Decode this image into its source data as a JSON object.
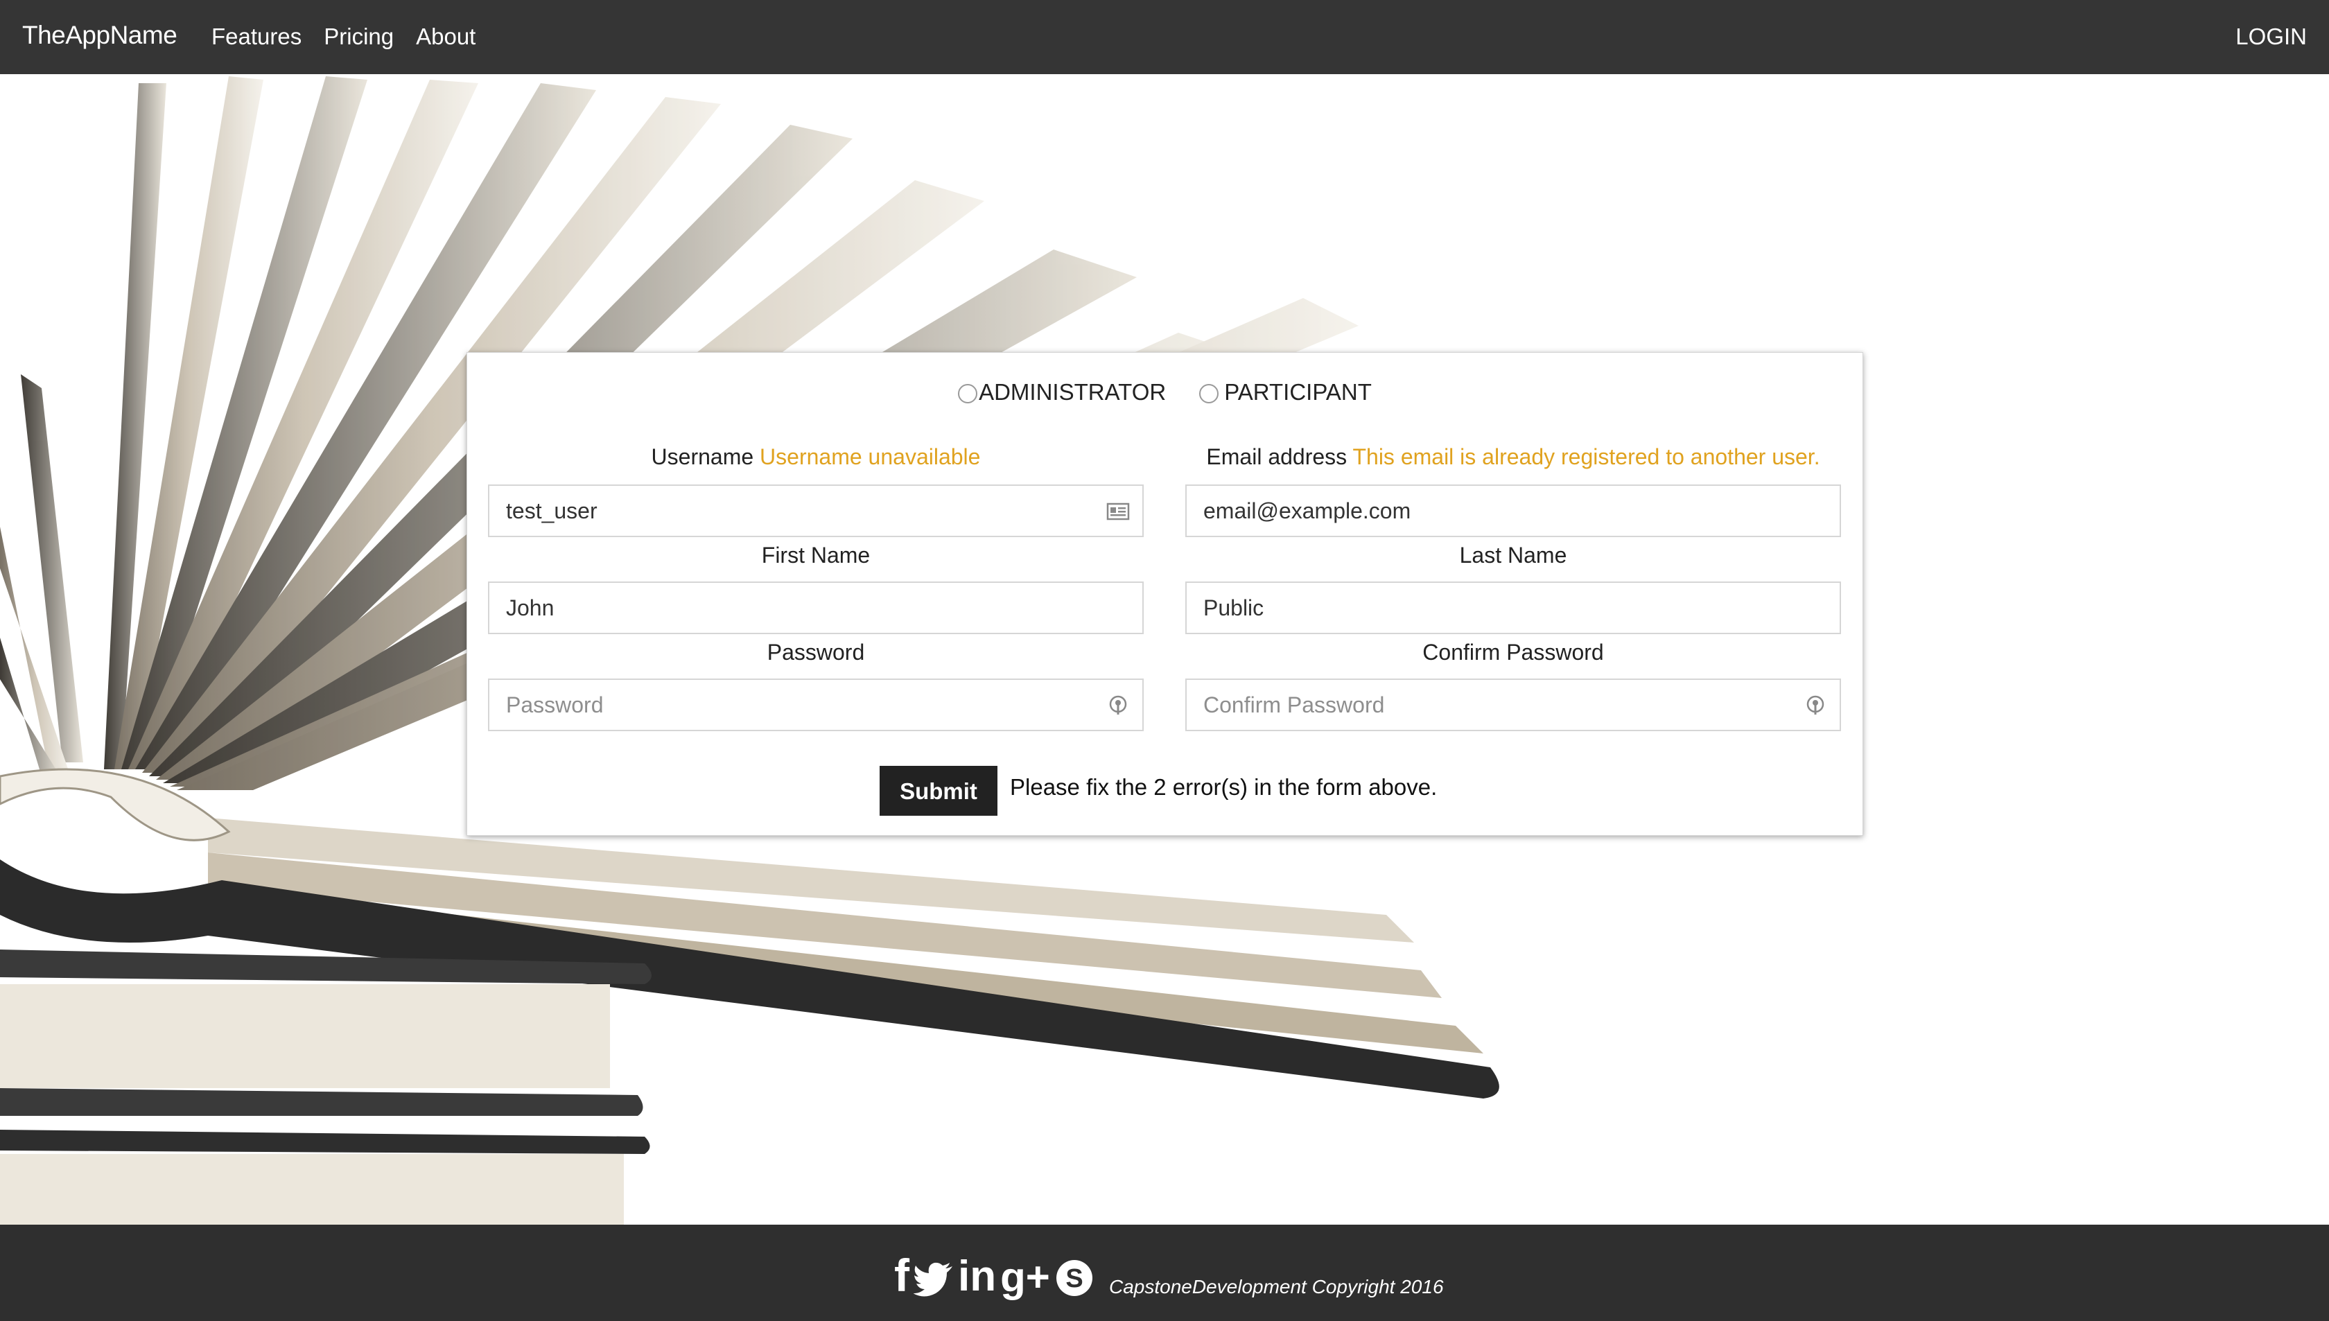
{
  "nav": {
    "brand": "TheAppName",
    "links": [
      "Features",
      "Pricing",
      "About"
    ],
    "login": "LOGIN"
  },
  "form": {
    "roles": [
      "ADMINISTRATOR",
      "PARTICIPANT"
    ],
    "username": {
      "label": "Username",
      "error": "Username unavailable",
      "value": "test_user",
      "icon": "contact-card-icon"
    },
    "email": {
      "label": "Email address",
      "error": "This email is already registered to another user.",
      "placeholder": "email@example.com"
    },
    "first_name": {
      "label": "First Name",
      "value": "John"
    },
    "last_name": {
      "label": "Last Name",
      "value": "Public"
    },
    "password": {
      "label": "Password",
      "placeholder": "Password",
      "icon": "key-icon"
    },
    "confirm_password": {
      "label": "Confirm Password",
      "placeholder": "Confirm Password",
      "icon": "key-icon"
    },
    "submit": "Submit",
    "message": "Please fix the 2 error(s) in the form above.",
    "error_color": "#e0a21f"
  },
  "footer": {
    "social": [
      "facebook-icon",
      "twitter-icon",
      "linkedin-icon",
      "google-plus-icon",
      "skype-icon"
    ],
    "copyright": "CapstoneDevelopment Copyright 2016"
  }
}
